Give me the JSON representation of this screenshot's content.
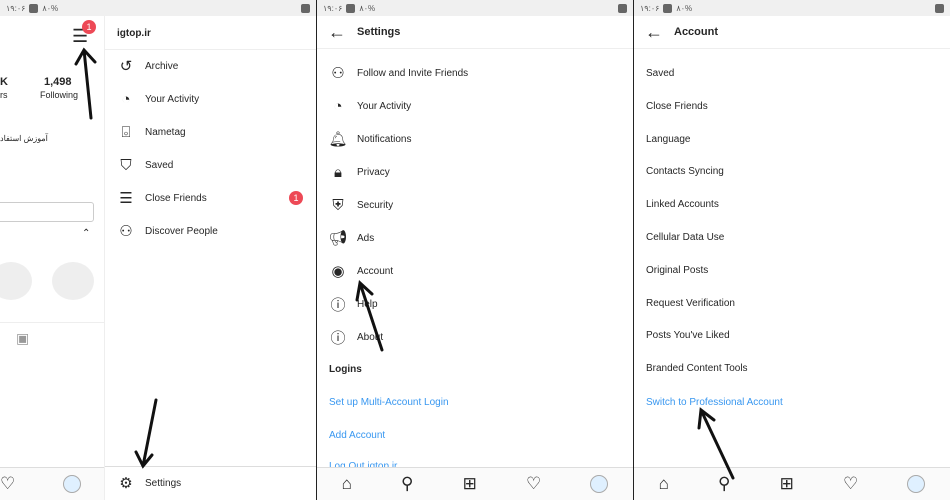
{
  "status": {
    "time": "۱۹:۰۶",
    "battery": "۸۰%"
  },
  "profile": {
    "followers_partial": "K",
    "followers_label_partial": "rs",
    "following_count": "1,498",
    "following_label": "Following",
    "bio": "آموزش استفاد",
    "menu_badge": "1"
  },
  "drawer": {
    "username": "igtop.ir",
    "items": [
      {
        "label": "Archive",
        "icon": "archive-icon"
      },
      {
        "label": "Your Activity",
        "icon": "activity-icon"
      },
      {
        "label": "Nametag",
        "icon": "nametag-icon"
      },
      {
        "label": "Saved",
        "icon": "bookmark-icon"
      },
      {
        "label": "Close Friends",
        "icon": "close-friends-icon",
        "badge": "1"
      },
      {
        "label": "Discover People",
        "icon": "add-person-icon"
      }
    ],
    "settings": "Settings"
  },
  "settings": {
    "title": "Settings",
    "items": [
      {
        "label": "Follow and Invite Friends"
      },
      {
        "label": "Your Activity"
      },
      {
        "label": "Notifications"
      },
      {
        "label": "Privacy"
      },
      {
        "label": "Security"
      },
      {
        "label": "Ads"
      },
      {
        "label": "Account"
      },
      {
        "label": "Help"
      },
      {
        "label": "About"
      }
    ],
    "logins_header": "Logins",
    "links": [
      "Set up Multi-Account Login",
      "Add Account",
      "Log Out igtop.ir"
    ]
  },
  "account": {
    "title": "Account",
    "items": [
      "Saved",
      "Close Friends",
      "Language",
      "Contacts Syncing",
      "Linked Accounts",
      "Cellular Data Use",
      "Original Posts",
      "Request Verification",
      "Posts You've Liked",
      "Branded Content Tools"
    ],
    "link": "Switch to Professional Account"
  },
  "colors": {
    "link": "#3897f0",
    "badge": "#ed4956"
  }
}
